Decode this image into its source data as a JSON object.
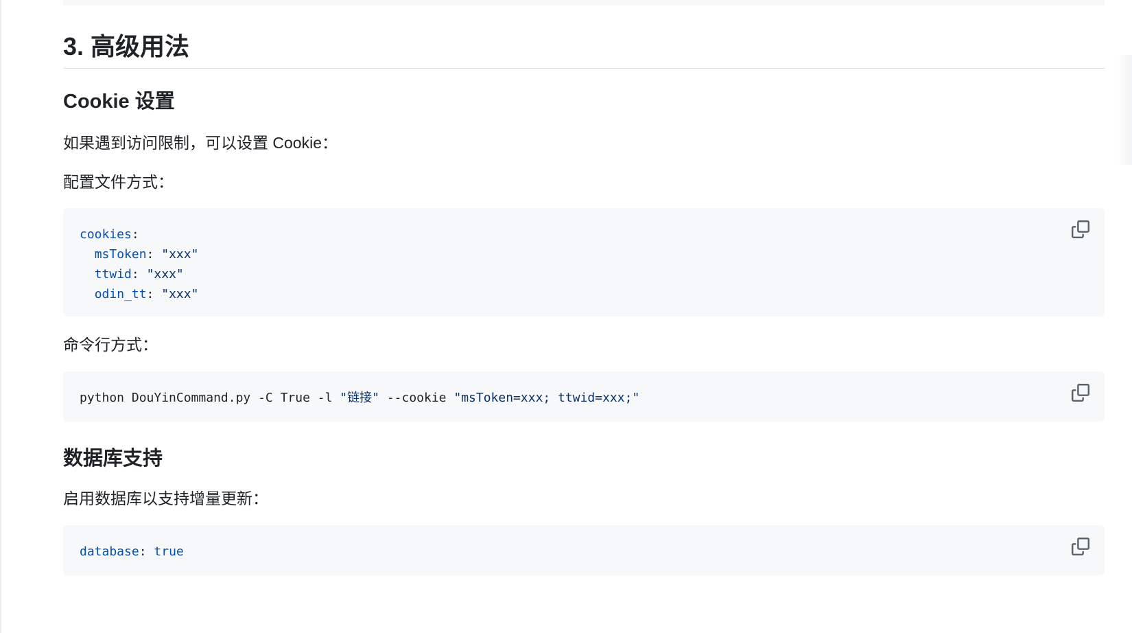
{
  "section": {
    "heading": "3. 高级用法"
  },
  "cookie": {
    "heading": "Cookie 设置",
    "intro": "如果遇到访问限制，可以设置 Cookie：",
    "config_label": "配置文件方式：",
    "config_code": {
      "lines": [
        {
          "key": "cookies",
          "sep": ":",
          "value": ""
        },
        {
          "indent": "  ",
          "key": "msToken",
          "sep": ": ",
          "value": "\"xxx\""
        },
        {
          "indent": "  ",
          "key": "ttwid",
          "sep": ": ",
          "value": "\"xxx\""
        },
        {
          "indent": "  ",
          "key": "odin_tt",
          "sep": ": ",
          "value": "\"xxx\""
        }
      ]
    },
    "cli_label": "命令行方式：",
    "cli_code": {
      "prefix": "python DouYinCommand.py -C True -l ",
      "arg_link": "\"链接\"",
      "middle": " --cookie ",
      "cookie_value": "\"msToken=xxx; ttwid=xxx;\""
    }
  },
  "database": {
    "heading": "数据库支持",
    "intro": "启用数据库以支持增量更新：",
    "code": {
      "key": "database",
      "sep": ": ",
      "value": "true"
    }
  },
  "icons": {
    "copy": "copy-icon"
  },
  "colors": {
    "code_background": "#f6f8fa",
    "code_key": "#0550ae",
    "code_string": "#0a3069",
    "text": "#1f2328",
    "divider": "#d8dee4"
  }
}
